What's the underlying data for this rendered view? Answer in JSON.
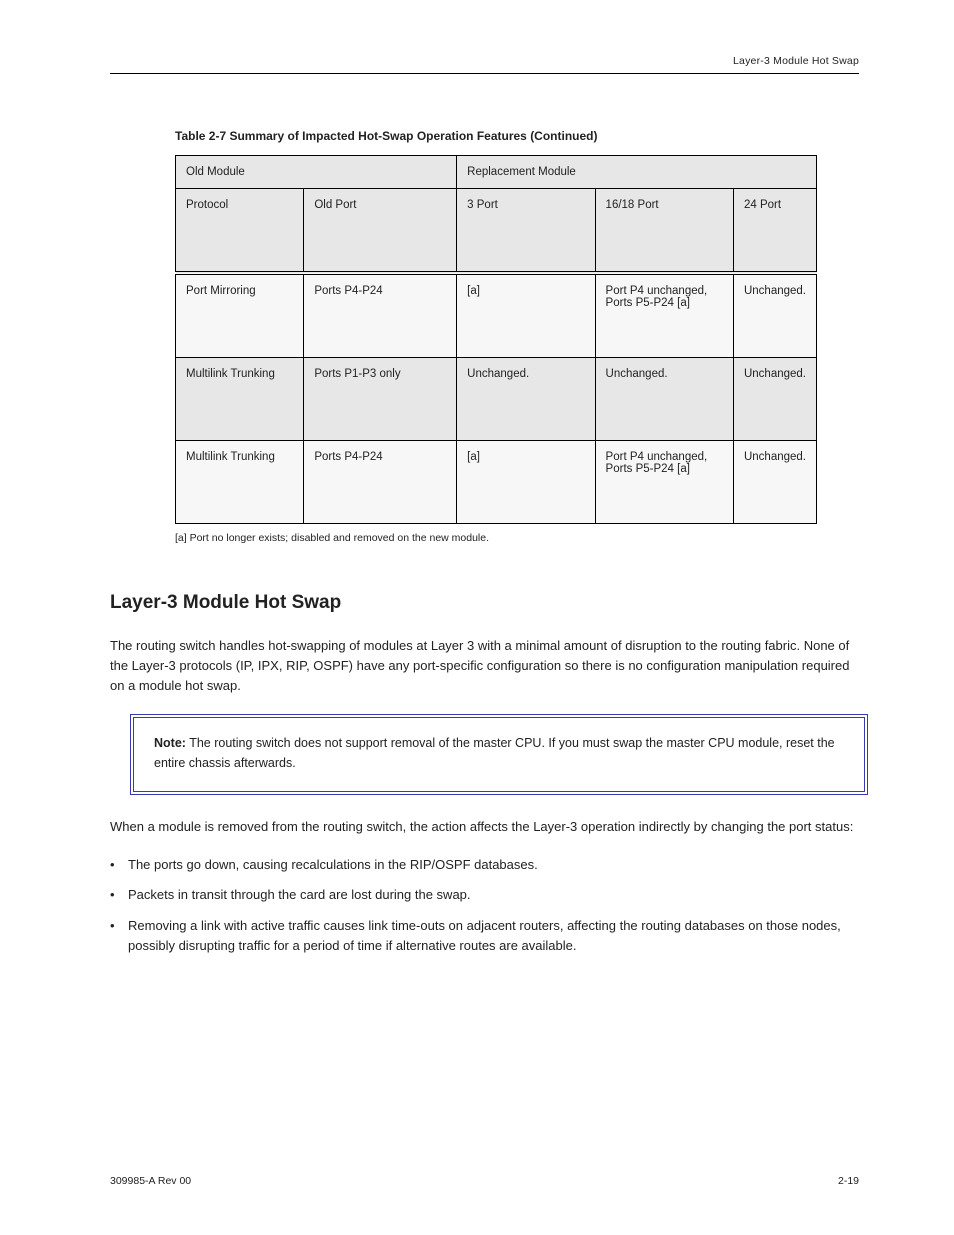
{
  "running_head": {
    "left": "",
    "right": "Layer-3 Module Hot Swap"
  },
  "table": {
    "caption": "Table 2-7  Summary of Impacted Hot-Swap Operation Features (Continued)",
    "header_group_a_span": 2,
    "header_group_a": "Old Module",
    "header_group_b_span": 3,
    "header_group_b": "Replacement Module",
    "subheaders": [
      "Protocol",
      "Old Port",
      "3 Port",
      "16/18 Port",
      "24 Port"
    ],
    "rows": [
      {
        "shaded": false,
        "cells": [
          "Port Mirroring",
          "Ports P4-P24",
          "[a]",
          "Port P4 unchanged, Ports P5-P24 [a]",
          "Unchanged."
        ]
      },
      {
        "shaded": true,
        "cells": [
          "Multilink Trunking",
          "Ports P1-P3 only",
          "Unchanged.",
          "Unchanged.",
          "Unchanged."
        ]
      },
      {
        "shaded": false,
        "cells": [
          "Multilink Trunking",
          "Ports P4-P24",
          "[a]",
          "Port P4 unchanged, Ports P5-P24 [a]",
          "Unchanged."
        ]
      }
    ]
  },
  "footnote": "[a]  Port no longer exists; disabled and removed on the new module.",
  "section": {
    "heading": "Layer-3 Module Hot Swap",
    "p1": "The routing switch handles hot-swapping of modules at Layer 3 with a minimal amount of disruption to the routing fabric. None of the Layer-3 protocols (IP, IPX, RIP, OSPF) have any port-specific configuration so there is no configuration manipulation required on a module hot swap.",
    "note_bold": "Note:",
    "note_text": " The routing switch does not support removal of the master CPU. If you must swap the master CPU module, reset the entire chassis afterwards.",
    "p2": "When a module is removed from the routing switch, the action affects the Layer-3 operation indirectly by changing the port status:",
    "items": [
      "The ports go down, causing recalculations in the RIP/OSPF databases.",
      "Packets in transit through the card are lost during the swap.",
      "Removing a link with active traffic causes link time-outs on adjacent routers, affecting the routing databases on those nodes, possibly disrupting traffic for a period of time if alternative routes are available."
    ]
  },
  "footer": {
    "left": "309985-A Rev 00",
    "right": "2-19"
  }
}
